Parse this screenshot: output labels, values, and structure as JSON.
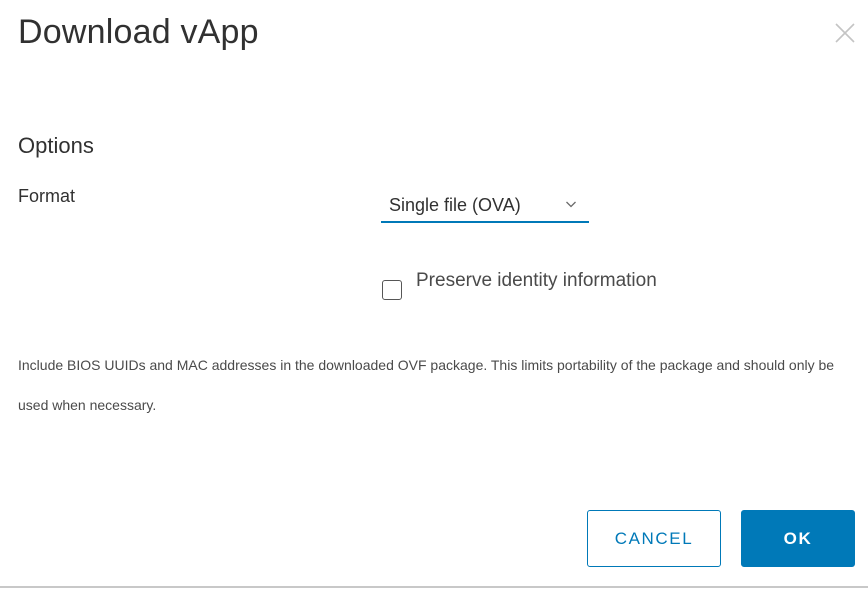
{
  "dialog": {
    "title": "Download vApp",
    "close_icon": "close-icon"
  },
  "options": {
    "heading": "Options",
    "format": {
      "label": "Format",
      "selected": "Single file (OVA)",
      "chevron_icon": "chevron-down-icon"
    },
    "preserve_identity": {
      "label": "Preserve identity information",
      "checked": false
    },
    "help_text": "Include BIOS UUIDs and MAC addresses in the downloaded OVF package. This limits portability of the package and should only be used when necessary."
  },
  "buttons": {
    "cancel_label": "CANCEL",
    "ok_label": "OK"
  },
  "colors": {
    "accent": "#0079b8",
    "text": "#313131"
  }
}
